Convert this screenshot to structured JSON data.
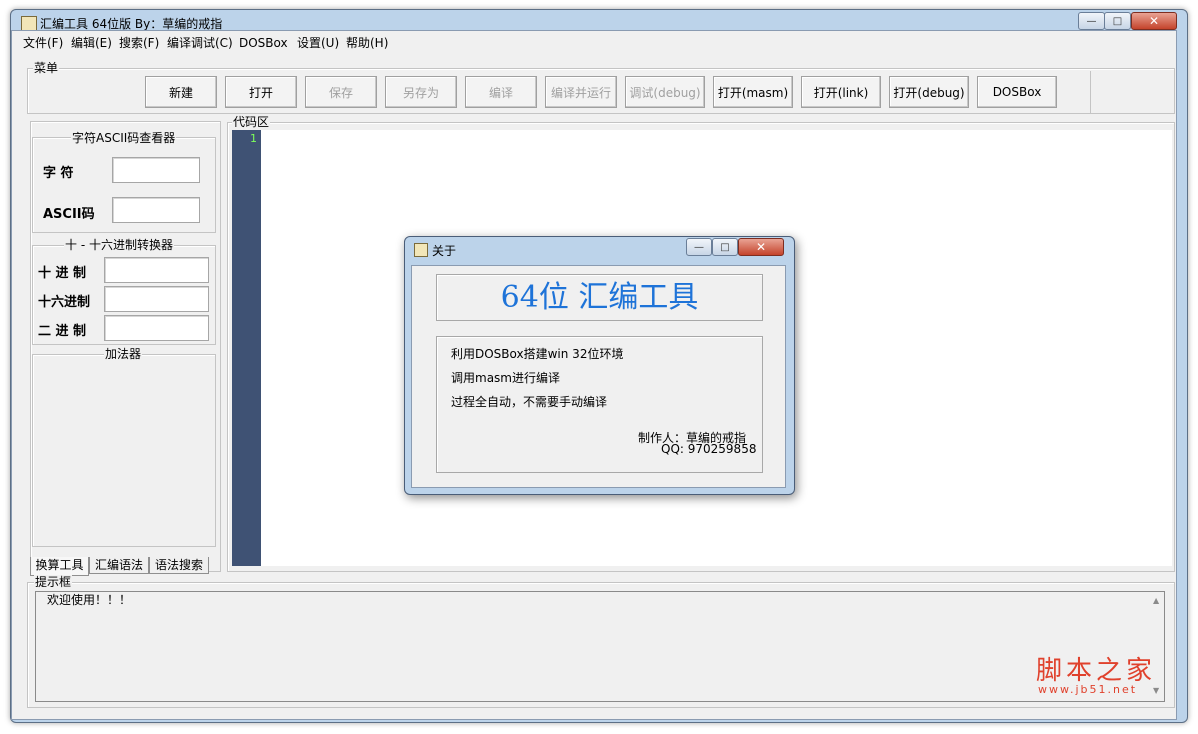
{
  "window": {
    "title": "汇编工具 64位版  By：草编的戒指",
    "minimize_glyph": "—",
    "maximize_glyph": "□",
    "close_glyph": "✕"
  },
  "menu": {
    "items": [
      {
        "label": "文件(F)"
      },
      {
        "label": "编辑(E)"
      },
      {
        "label": "搜索(F)"
      },
      {
        "label": "编译调试(C)"
      },
      {
        "label": "DOSBox"
      },
      {
        "label": "设置(U)"
      },
      {
        "label": "帮助(H)"
      }
    ]
  },
  "toolbar": {
    "group_label": "菜单",
    "buttons": [
      {
        "label": "新建",
        "enabled": true
      },
      {
        "label": "打开",
        "enabled": true
      },
      {
        "label": "保存",
        "enabled": false
      },
      {
        "label": "另存为",
        "enabled": false
      },
      {
        "label": "编译",
        "enabled": false
      },
      {
        "label": "编译并运行",
        "enabled": false
      },
      {
        "label": "调试(debug)",
        "enabled": false
      },
      {
        "label": "打开(masm)",
        "enabled": true
      },
      {
        "label": "打开(link)",
        "enabled": true
      },
      {
        "label": "打开(debug)",
        "enabled": true
      },
      {
        "label": "DOSBox",
        "enabled": true
      }
    ]
  },
  "ascii_viewer": {
    "title": "字符ASCII码查看器",
    "char_label": "字  符",
    "char_value": "",
    "ascii_label": "ASCII码",
    "ascii_value": ""
  },
  "converter": {
    "title": "十 - 十六进制转换器",
    "decimal_label": "十 进 制",
    "decimal_value": "",
    "hex_label": "十六进制",
    "hex_value": "",
    "binary_label": "二 进 制",
    "binary_value": ""
  },
  "adder": {
    "title": "加法器"
  },
  "tabs": [
    {
      "label": "换算工具",
      "active": true
    },
    {
      "label": "汇编语法",
      "active": false
    },
    {
      "label": "语法搜索",
      "active": false
    }
  ],
  "code_area": {
    "label": "代码区",
    "line_numbers": [
      "1"
    ],
    "gutter_color": "#3f5274",
    "line_number_color": "#7cff5a"
  },
  "hint_box": {
    "label": "提示框",
    "text": "欢迎使用！！！"
  },
  "about_dialog": {
    "title": "关于",
    "heading": "64位 汇编工具",
    "heading_color": "#1e73d8",
    "lines": [
      "利用DOSBox搭建win 32位环境",
      "调用masm进行编译",
      "过程全自动，不需要手动编译"
    ],
    "author": "制作人：草编的戒指",
    "qq": "QQ: 970259858"
  },
  "watermark": {
    "title": "脚本之家",
    "url": "www.jb51.net",
    "color": "#e0412c"
  }
}
